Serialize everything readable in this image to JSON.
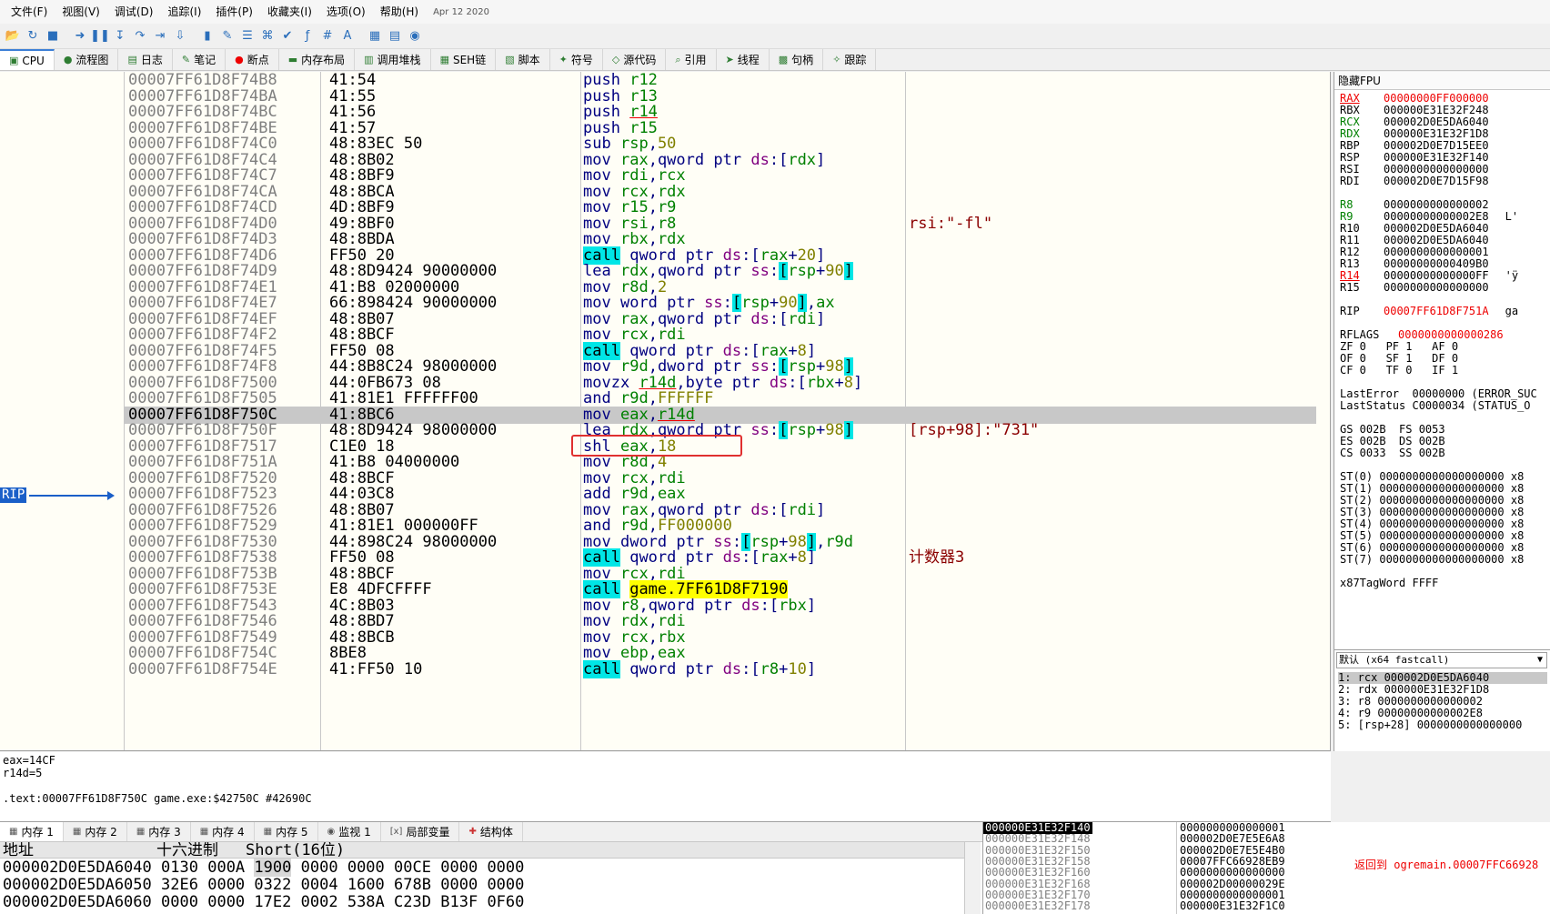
{
  "menu": [
    "文件(F)",
    "视图(V)",
    "调试(D)",
    "追踪(I)",
    "插件(P)",
    "收藏夹(I)",
    "选项(O)",
    "帮助(H)"
  ],
  "menu_date": "Apr 12 2020",
  "toolbar_icons": [
    "open-icon",
    "restart-icon",
    "close-icon",
    "run-icon",
    "pause-icon",
    "step-into-icon",
    "step-over-icon",
    "run-to-return-icon",
    "run-to-user-icon",
    "patch-icon",
    "script-icon",
    "comment-icon",
    "label-icon",
    "bookmark-icon",
    "function-icon",
    "hash-icon",
    "font-icon",
    "calculator-icon",
    "log-icon",
    "help-icon"
  ],
  "tabs": [
    {
      "label": "CPU",
      "icon": "cpu-icon",
      "active": true
    },
    {
      "label": "流程图"
    },
    {
      "label": "日志"
    },
    {
      "label": "笔记"
    },
    {
      "label": "断点"
    },
    {
      "label": "内存布局"
    },
    {
      "label": "调用堆栈"
    },
    {
      "label": "SEH链"
    },
    {
      "label": "脚本"
    },
    {
      "label": "符号"
    },
    {
      "label": "源代码"
    },
    {
      "label": "引用"
    },
    {
      "label": "线程"
    },
    {
      "label": "句柄"
    },
    {
      "label": "跟踪"
    }
  ],
  "disasm": {
    "rip_label": "RIP",
    "rows": [
      {
        "addr": "00007FF61D8F74B8",
        "bytes": "41:54",
        "ins": "push r12"
      },
      {
        "addr": "00007FF61D8F74BA",
        "bytes": "41:55",
        "ins": "push r13"
      },
      {
        "addr": "00007FF61D8F74BC",
        "bytes": "41:56",
        "ins": "push r14"
      },
      {
        "addr": "00007FF61D8F74BE",
        "bytes": "41:57",
        "ins": "push r15"
      },
      {
        "addr": "00007FF61D8F74C0",
        "bytes": "48:83EC 50",
        "ins": "sub rsp,50"
      },
      {
        "addr": "00007FF61D8F74C4",
        "bytes": "48:8B02",
        "ins": "mov rax,qword ptr ds:[rdx]"
      },
      {
        "addr": "00007FF61D8F74C7",
        "bytes": "48:8BF9",
        "ins": "mov rdi,rcx"
      },
      {
        "addr": "00007FF61D8F74CA",
        "bytes": "48:8BCA",
        "ins": "mov rcx,rdx"
      },
      {
        "addr": "00007FF61D8F74CD",
        "bytes": "4D:8BF9",
        "ins": "mov r15,r9"
      },
      {
        "addr": "00007FF61D8F74D0",
        "bytes": "49:8BF0",
        "ins": "mov rsi,r8",
        "cmt": "rsi:\"-fl\""
      },
      {
        "addr": "00007FF61D8F74D3",
        "bytes": "48:8BDA",
        "ins": "mov rbx,rdx"
      },
      {
        "addr": "00007FF61D8F74D6",
        "bytes": "FF50 20",
        "ins": "call qword ptr ds:[rax+20]"
      },
      {
        "addr": "00007FF61D8F74D9",
        "bytes": "48:8D9424 90000000",
        "ins": "lea rdx,qword ptr ss:[rsp+90]"
      },
      {
        "addr": "00007FF61D8F74E1",
        "bytes": "41:B8 02000000",
        "ins": "mov r8d,2"
      },
      {
        "addr": "00007FF61D8F74E7",
        "bytes": "66:898424 90000000",
        "ins": "mov word ptr ss:[rsp+90],ax"
      },
      {
        "addr": "00007FF61D8F74EF",
        "bytes": "48:8B07",
        "ins": "mov rax,qword ptr ds:[rdi]"
      },
      {
        "addr": "00007FF61D8F74F2",
        "bytes": "48:8BCF",
        "ins": "mov rcx,rdi"
      },
      {
        "addr": "00007FF61D8F74F5",
        "bytes": "FF50 08",
        "ins": "call qword ptr ds:[rax+8]"
      },
      {
        "addr": "00007FF61D8F74F8",
        "bytes": "44:8B8C24 98000000",
        "ins": "mov r9d,dword ptr ss:[rsp+98]"
      },
      {
        "addr": "00007FF61D8F7500",
        "bytes": "44:0FB673 08",
        "ins": "movzx r14d,byte ptr ds:[rbx+8]"
      },
      {
        "addr": "00007FF61D8F7505",
        "bytes": "41:81E1 FFFFFF00",
        "ins": "and r9d,FFFFFF"
      },
      {
        "addr": "00007FF61D8F750C",
        "bytes": "41:8BC6",
        "ins": "mov eax,r14d",
        "selected": true
      },
      {
        "addr": "00007FF61D8F750F",
        "bytes": "48:8D9424 98000000",
        "ins": "lea rdx,qword ptr ss:[rsp+98]",
        "cmt": "[rsp+98]:\"731\""
      },
      {
        "addr": "00007FF61D8F7517",
        "bytes": "C1E0 18",
        "ins": "shl eax,18"
      },
      {
        "addr": "00007FF61D8F751A",
        "bytes": "41:B8 04000000",
        "ins": "mov r8d,4"
      },
      {
        "addr": "00007FF61D8F7520",
        "bytes": "48:8BCF",
        "ins": "mov rcx,rdi"
      },
      {
        "addr": "00007FF61D8F7523",
        "bytes": "44:03C8",
        "ins": "add r9d,eax"
      },
      {
        "addr": "00007FF61D8F7526",
        "bytes": "48:8B07",
        "ins": "mov rax,qword ptr ds:[rdi]"
      },
      {
        "addr": "00007FF61D8F7529",
        "bytes": "41:81E1 000000FF",
        "ins": "and r9d,FF000000"
      },
      {
        "addr": "00007FF61D8F7530",
        "bytes": "44:898C24 98000000",
        "ins": "mov dword ptr ss:[rsp+98],r9d"
      },
      {
        "addr": "00007FF61D8F7538",
        "bytes": "FF50 08",
        "ins": "call qword ptr ds:[rax+8]",
        "cmt": "计数器3"
      },
      {
        "addr": "00007FF61D8F753B",
        "bytes": "48:8BCF",
        "ins": "mov rcx,rdi"
      },
      {
        "addr": "00007FF61D8F753E",
        "bytes": "E8 4DFCFFFF",
        "ins": "call game.7FF61D8F7190"
      },
      {
        "addr": "00007FF61D8F7543",
        "bytes": "4C:8B03",
        "ins": "mov r8,qword ptr ds:[rbx]"
      },
      {
        "addr": "00007FF61D8F7546",
        "bytes": "48:8BD7",
        "ins": "mov rdx,rdi"
      },
      {
        "addr": "00007FF61D8F7549",
        "bytes": "48:8BCB",
        "ins": "mov rcx,rbx"
      },
      {
        "addr": "00007FF61D8F754C",
        "bytes": "8BE8",
        "ins": "mov ebp,eax"
      },
      {
        "addr": "00007FF61D8F754E",
        "bytes": "41:FF50 10",
        "ins": "call qword ptr ds:[r8+10]"
      }
    ]
  },
  "info": {
    "line1": "eax=14CF",
    "line2": "r14d=5",
    "line3": ".text:00007FF61D8F750C game.exe:$42750C #42690C"
  },
  "registers": {
    "header": "隐藏FPU",
    "gp": [
      {
        "n": "RAX",
        "v": "00000000FF000000",
        "changed": true,
        "under": true
      },
      {
        "n": "RBX",
        "v": "000000E31E32F248"
      },
      {
        "n": "RCX",
        "v": "000002D0E5DA6040",
        "green": true
      },
      {
        "n": "RDX",
        "v": "000000E31E32F1D8",
        "green": true
      },
      {
        "n": "RBP",
        "v": "000002D0E7D15EE0"
      },
      {
        "n": "RSP",
        "v": "000000E31E32F140"
      },
      {
        "n": "RSI",
        "v": "0000000000000000"
      },
      {
        "n": "RDI",
        "v": "000002D0E7D15F98"
      }
    ],
    "ext": [
      {
        "n": "R8",
        "v": "0000000000000002",
        "green": true
      },
      {
        "n": "R9",
        "v": "00000000000002E8",
        "green": true,
        "s": "L'"
      },
      {
        "n": "R10",
        "v": "000002D0E5DA6040"
      },
      {
        "n": "R11",
        "v": "000002D0E5DA6040"
      },
      {
        "n": "R12",
        "v": "0000000000000001"
      },
      {
        "n": "R13",
        "v": "00000000000409B0"
      },
      {
        "n": "R14",
        "v": "00000000000000FF",
        "under": true,
        "s": "'ÿ"
      },
      {
        "n": "R15",
        "v": "0000000000000000"
      }
    ],
    "rip": {
      "n": "RIP",
      "v": "00007FF61D8F751A",
      "s": "ga"
    },
    "rflags": {
      "n": "RFLAGS",
      "v": "0000000000000286"
    },
    "flags": [
      "ZF 0   PF 1   AF 0",
      "OF 0   SF 1   DF 0",
      "CF 0   TF 0   IF 1"
    ],
    "last_error": "LastError  00000000 (ERROR_SUC",
    "last_status": "LastStatus C0000034 (STATUS_O",
    "segs": [
      "GS 002B  FS 0053",
      "ES 002B  DS 002B",
      "CS 0033  SS 002B"
    ],
    "st": [
      "ST(0) 0000000000000000000 x8",
      "ST(1) 0000000000000000000 x8",
      "ST(2) 0000000000000000000 x8",
      "ST(3) 0000000000000000000 x8",
      "ST(4) 0000000000000000000 x8",
      "ST(5) 0000000000000000000 x8",
      "ST(6) 0000000000000000000 x8",
      "ST(7) 0000000000000000000 x8"
    ],
    "tagword": "x87TagWord FFFF"
  },
  "callconv": {
    "selected": "默认 (x64 fastcall)",
    "args": [
      "1: rcx 000002D0E5DA6040",
      "2: rdx 000000E31E32F1D8",
      "3: r8 0000000000000002",
      "4: r9 00000000000002E8",
      "5: [rsp+28] 0000000000000000"
    ]
  },
  "mem_tabs": [
    {
      "label": "内存 1",
      "active": true
    },
    {
      "label": "内存 2"
    },
    {
      "label": "内存 3"
    },
    {
      "label": "内存 4"
    },
    {
      "label": "内存 5"
    },
    {
      "label": "监视 1"
    },
    {
      "label": "局部变量"
    },
    {
      "label": "结构体"
    }
  ],
  "dump": {
    "col_addr": "地址",
    "col_hex": "十六进制",
    "col_mode": "Short(16位)",
    "rows": [
      {
        "addr": "000002D0E5DA6040",
        "vals": [
          "0130",
          "000A",
          "1900",
          "0000",
          "0000",
          "00CE",
          "0000",
          "0000"
        ]
      },
      {
        "addr": "000002D0E5DA6050",
        "vals": [
          "32E6",
          "0000",
          "0322",
          "0004",
          "1600",
          "678B",
          "0000",
          "0000"
        ]
      },
      {
        "addr": "000002D0E5DA6060",
        "vals": [
          "0000",
          "0000",
          "17E2",
          "0002",
          "538A",
          "C23D",
          "B13F",
          "0F60"
        ]
      }
    ]
  },
  "stack": {
    "rows": [
      {
        "a": "000000E31E32F140",
        "v": "0000000000000001",
        "top": true
      },
      {
        "a": "000000E31E32F148",
        "v": "000002D0E7E5E6A8"
      },
      {
        "a": "000000E31E32F150",
        "v": "000002D0E7E5E4B0"
      },
      {
        "a": "000000E31E32F158",
        "v": "00007FFC66928EB9"
      },
      {
        "a": "000000E31E32F160",
        "v": "0000000000000000"
      },
      {
        "a": "000000E31E32F168",
        "v": "000002D00000029E"
      },
      {
        "a": "000000E31E32F170",
        "v": "0000000000000001"
      },
      {
        "a": "000000E31E32F178",
        "v": "000000E31E32F1C0"
      }
    ],
    "comment": "返回到 ogremain.00007FFC66928"
  }
}
